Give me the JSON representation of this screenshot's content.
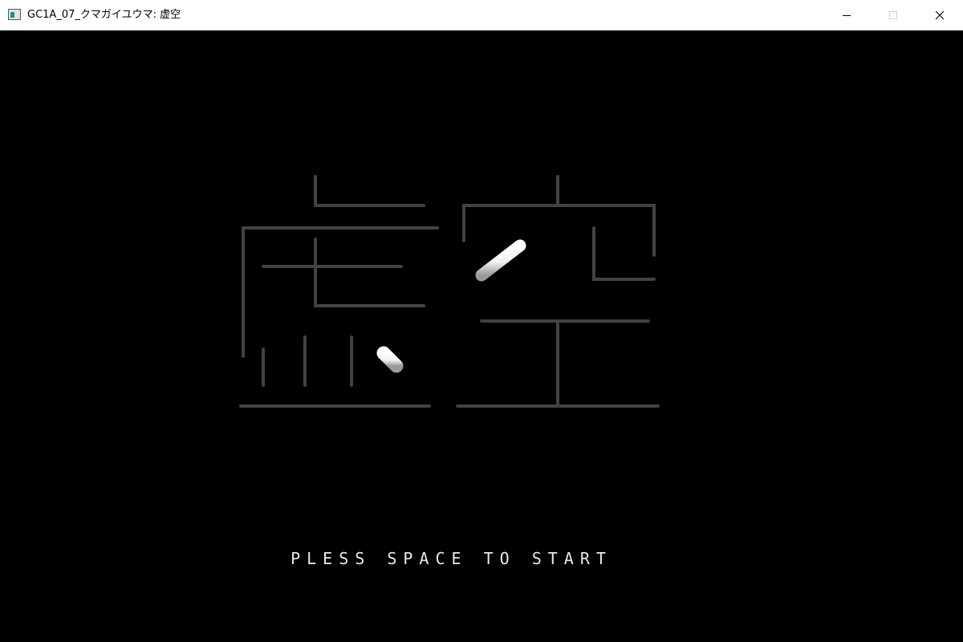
{
  "window": {
    "title": "GC1A_07_クマガイユウマ: 虚空",
    "controls": {
      "minimize": "minimize-icon",
      "maximize": "maximize-icon",
      "close": "close-icon"
    }
  },
  "game": {
    "logo_text": "虚空",
    "prompt": "PLESS SPACE TO START",
    "colors": {
      "background": "#000000",
      "logo_fill": "#ffffff",
      "logo_shade": "#555555",
      "prompt": "#e8e8e8"
    }
  }
}
